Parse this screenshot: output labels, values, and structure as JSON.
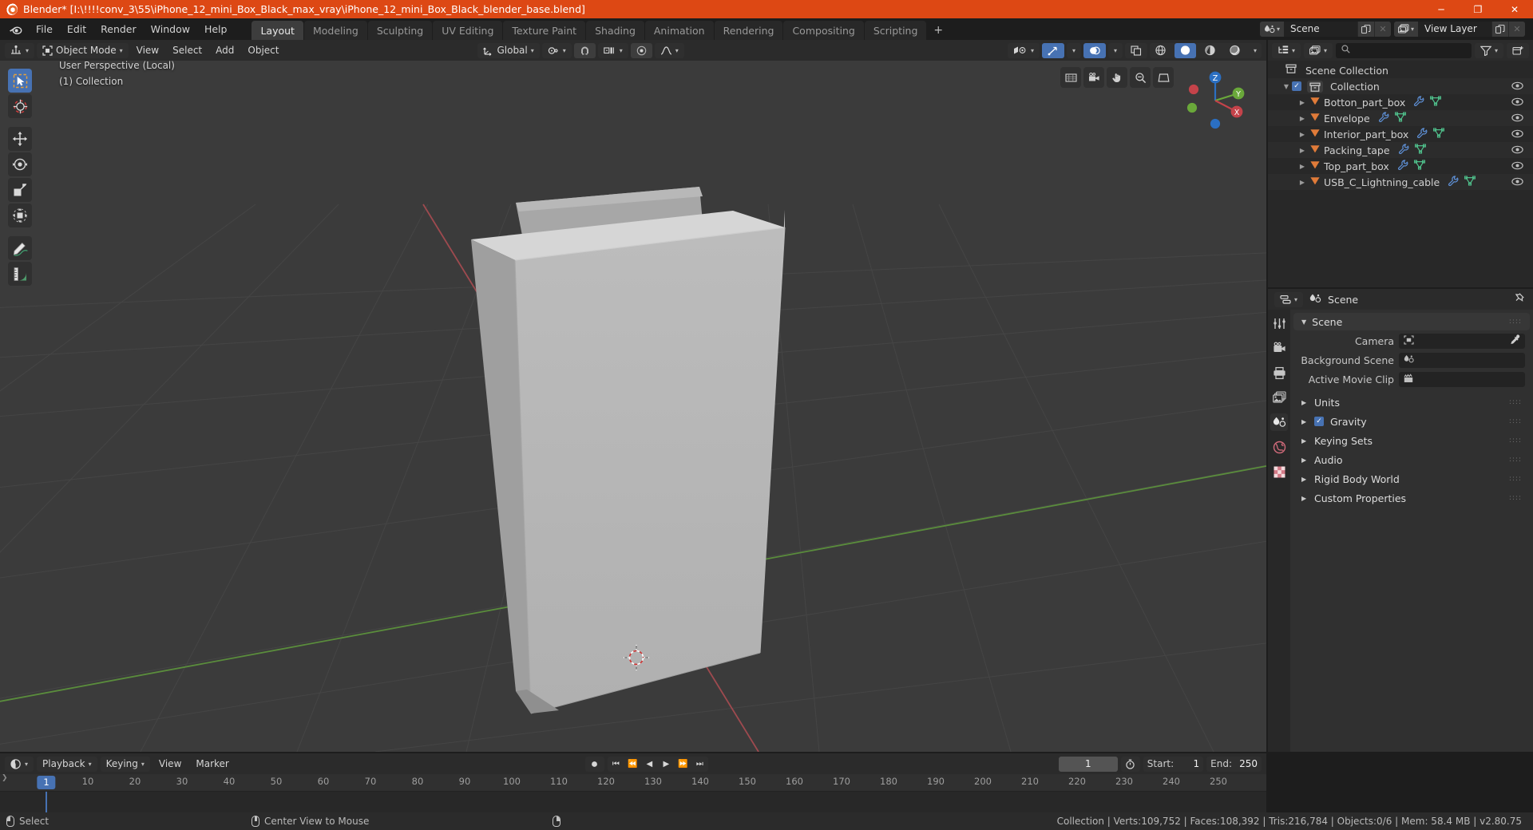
{
  "window": {
    "title": "Blender* [I:\\!!!!conv_3\\55\\iPhone_12_mini_Box_Black_max_vray\\iPhone_12_mini_Box_Black_blender_base.blend]",
    "logo_icon": "blender-logo-icon",
    "minimize_label": "─",
    "maximize_label": "❐",
    "close_label": "✕"
  },
  "topbar": {
    "logo_icon": "blender-logo-icon",
    "menus": [
      "File",
      "Edit",
      "Render",
      "Window",
      "Help"
    ],
    "workspaces": [
      {
        "label": "Layout",
        "active": true
      },
      {
        "label": "Modeling",
        "active": false
      },
      {
        "label": "Sculpting",
        "active": false
      },
      {
        "label": "UV Editing",
        "active": false
      },
      {
        "label": "Texture Paint",
        "active": false
      },
      {
        "label": "Shading",
        "active": false
      },
      {
        "label": "Animation",
        "active": false
      },
      {
        "label": "Rendering",
        "active": false
      },
      {
        "label": "Compositing",
        "active": false
      },
      {
        "label": "Scripting",
        "active": false
      }
    ],
    "add_workspace_label": "+",
    "scene": {
      "name": "Scene",
      "icon": "scene-icon",
      "new_icon": "copy-icon",
      "unlink_icon": "x-icon"
    },
    "view_layer": {
      "name": "View Layer",
      "icon": "view-layer-icon",
      "new_icon": "copy-icon",
      "unlink_icon": "x-icon"
    }
  },
  "viewport": {
    "header": {
      "editor_type_icon": "editor-type-3dview-icon",
      "mode": "Object Mode",
      "mode_icon": "object-mode-icon",
      "menus": [
        "View",
        "Select",
        "Add",
        "Object"
      ],
      "transform_orientation": "Global",
      "transform_orientation_icon": "orientation-axes-icon",
      "pivot_icon": "pivot-point-icon",
      "snap_icon": "magnet-icon",
      "snap_target_icon": "snap-increment-icon",
      "proportional_icon": "proportional-edit-icon",
      "falloff_icon": "falloff-curve-icon",
      "visibility_icon": "object-types-visibility-icon",
      "gizmo_icon": "gizmo-icon",
      "overlays_icon": "overlays-icon",
      "xray_icon": "xray-icon",
      "shading_modes": [
        "wireframe",
        "solid",
        "material-preview",
        "rendered"
      ],
      "shading_active": "solid"
    },
    "overlay_line1": "User Perspective (Local)",
    "overlay_line2": "(1) Collection",
    "tools": [
      {
        "name": "tweak-select-box-tool",
        "icon": "cursor-box-select-icon",
        "active": true
      },
      {
        "name": "cursor-tool",
        "icon": "3d-cursor-icon",
        "active": false
      },
      {
        "name": "move-tool",
        "icon": "move-arrows-icon",
        "active": false
      },
      {
        "name": "rotate-tool",
        "icon": "rotate-icon",
        "active": false
      },
      {
        "name": "scale-tool",
        "icon": "scale-icon",
        "active": false
      },
      {
        "name": "transform-tool",
        "icon": "transform-icon",
        "active": false
      },
      {
        "name": "annotate-tool",
        "icon": "pencil-icon",
        "active": false
      },
      {
        "name": "measure-tool",
        "icon": "ruler-icon",
        "active": false
      }
    ],
    "gizmo": {
      "x_label": "X",
      "y_label": "Y",
      "z_label": "Z"
    },
    "nav_icons": [
      "zoom-region-icon",
      "camera-view-icon",
      "move-view-icon",
      "zoom-view-icon",
      "toggle-perspective-icon"
    ]
  },
  "outliner": {
    "display_mode_icon": "outliner-display-mode-icon",
    "filter_id_icon": "view-layer-icon",
    "search_placeholder": "",
    "search_icon": "search-icon",
    "filter_icon": "filter-funnel-icon",
    "new_collection_icon": "new-collection-icon",
    "rows": [
      {
        "label": "Scene Collection",
        "indent": 0,
        "icon": "collection-icon",
        "disclosure": "",
        "checkbox": false,
        "modifier_icons": [],
        "eye": false
      },
      {
        "label": "Collection",
        "indent": 1,
        "icon": "collection-icon",
        "disclosure": "▼",
        "checkbox": true,
        "modifier_icons": [],
        "eye": true
      },
      {
        "label": "Botton_part_box",
        "indent": 2,
        "icon": "mesh-object-icon",
        "disclosure": "▶",
        "checkbox": false,
        "modifier_icons": [
          "wrench-icon",
          "mesh-data-icon"
        ],
        "eye": true
      },
      {
        "label": "Envelope",
        "indent": 2,
        "icon": "mesh-object-icon",
        "disclosure": "▶",
        "checkbox": false,
        "modifier_icons": [
          "wrench-icon",
          "mesh-data-icon"
        ],
        "eye": true
      },
      {
        "label": "Interior_part_box",
        "indent": 2,
        "icon": "mesh-object-icon",
        "disclosure": "▶",
        "checkbox": false,
        "modifier_icons": [
          "wrench-icon",
          "mesh-data-icon"
        ],
        "eye": true
      },
      {
        "label": "Packing_tape",
        "indent": 2,
        "icon": "mesh-object-icon",
        "disclosure": "▶",
        "checkbox": false,
        "modifier_icons": [
          "wrench-icon",
          "mesh-data-icon"
        ],
        "eye": true
      },
      {
        "label": "Top_part_box",
        "indent": 2,
        "icon": "mesh-object-icon",
        "disclosure": "▶",
        "checkbox": false,
        "modifier_icons": [
          "wrench-icon",
          "mesh-data-icon"
        ],
        "eye": true
      },
      {
        "label": "USB_C_Lightning_cable",
        "indent": 2,
        "icon": "mesh-object-icon",
        "disclosure": "▶",
        "checkbox": false,
        "modifier_icons": [
          "wrench-icon",
          "mesh-data-icon"
        ],
        "eye": true
      }
    ]
  },
  "properties": {
    "editor_type_icon": "editor-type-properties-icon",
    "breadcrumb_icon": "scene-icon",
    "breadcrumb": "Scene",
    "pin_icon": "pin-icon",
    "tabs": [
      {
        "name": "tool-tab",
        "icon": "tool-icon",
        "active": false
      },
      {
        "name": "render-tab",
        "icon": "render-camera-icon",
        "active": false
      },
      {
        "name": "output-tab",
        "icon": "printer-icon",
        "active": false
      },
      {
        "name": "view-layer-tab",
        "icon": "images-icon",
        "active": false
      },
      {
        "name": "scene-tab",
        "icon": "scene-icon",
        "active": true
      },
      {
        "name": "world-tab",
        "icon": "world-globe-icon",
        "active": false
      },
      {
        "name": "texture-tab",
        "icon": "checker-texture-icon",
        "active": false
      }
    ],
    "scene_panel": {
      "title": "Scene",
      "expanded": true,
      "fields": [
        {
          "label": "Camera",
          "value": "",
          "icon": "camera-object-icon",
          "eyedropper": true
        },
        {
          "label": "Background Scene",
          "value": "",
          "icon": "scene-icon",
          "eyedropper": false
        },
        {
          "label": "Active Movie Clip",
          "value": "",
          "icon": "movie-clip-icon",
          "eyedropper": false
        }
      ]
    },
    "panels": [
      {
        "label": "Units",
        "checkbox": false,
        "expanded": false
      },
      {
        "label": "Gravity",
        "checkbox": true,
        "expanded": false
      },
      {
        "label": "Keying Sets",
        "checkbox": false,
        "expanded": false
      },
      {
        "label": "Audio",
        "checkbox": false,
        "expanded": false
      },
      {
        "label": "Rigid Body World",
        "checkbox": false,
        "expanded": false
      },
      {
        "label": "Custom Properties",
        "checkbox": false,
        "expanded": false
      }
    ]
  },
  "timeline": {
    "editor_type_icon": "editor-type-timeline-icon",
    "menus": [
      "Playback",
      "Keying",
      "View",
      "Marker"
    ],
    "record_icon": "record-icon",
    "transport": [
      {
        "name": "jump-to-start-button",
        "icon": "⏮"
      },
      {
        "name": "jump-to-prev-keyframe-button",
        "icon": "⏪"
      },
      {
        "name": "play-reverse-button",
        "icon": "◀"
      },
      {
        "name": "play-button",
        "icon": "▶"
      },
      {
        "name": "jump-to-next-keyframe-button",
        "icon": "⏩"
      },
      {
        "name": "jump-to-end-button",
        "icon": "⏭"
      }
    ],
    "current_frame": "1",
    "use_preview_range_icon": "stopwatch-icon",
    "start_label": "Start:",
    "start_value": "1",
    "end_label": "End:",
    "end_value": "250",
    "ruler_ticks": [
      "1",
      "10",
      "20",
      "30",
      "40",
      "50",
      "60",
      "70",
      "80",
      "90",
      "100",
      "110",
      "120",
      "130",
      "140",
      "150",
      "160",
      "170",
      "180",
      "190",
      "200",
      "210",
      "220",
      "230",
      "240",
      "250"
    ]
  },
  "statusbar": {
    "items": [
      {
        "mouse": "lmb",
        "label": "Select"
      },
      {
        "mouse": "mmb",
        "label": "Center View to Mouse"
      },
      {
        "mouse": "rmb",
        "label": ""
      }
    ],
    "stats": "Collection | Verts:109,752 | Faces:108,392 | Tris:216,784 | Objects:0/6 | Mem: 58.4 MB | v2.80.75"
  },
  "colors": {
    "accent": "#4772b3",
    "brand": "#dd4814",
    "bg_dark": "#1d1d1d",
    "bg_panel": "#282828",
    "viewport": "#3b3b3b"
  }
}
